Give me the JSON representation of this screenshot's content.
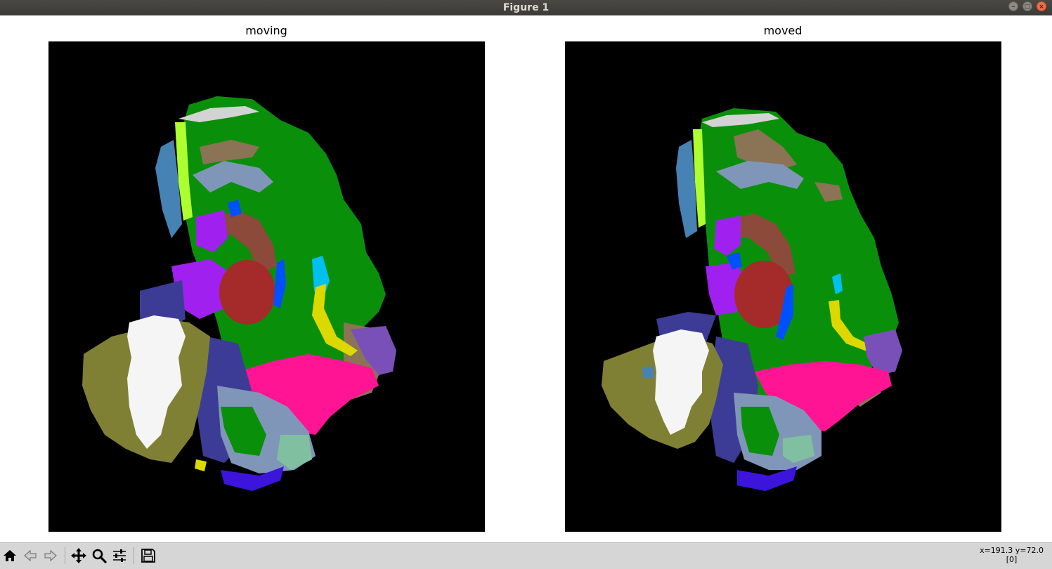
{
  "window": {
    "title": "Figure 1"
  },
  "axes": [
    {
      "title": "moving"
    },
    {
      "title": "moved"
    }
  ],
  "toolbar": {
    "buttons": [
      {
        "name": "home",
        "icon": "home-icon"
      },
      {
        "name": "back",
        "icon": "arrow-left-icon"
      },
      {
        "name": "forward",
        "icon": "arrow-right-icon"
      },
      {
        "name": "pan",
        "icon": "move-icon"
      },
      {
        "name": "zoom",
        "icon": "magnifier-icon"
      },
      {
        "name": "configure-subplots",
        "icon": "sliders-icon"
      },
      {
        "name": "save",
        "icon": "floppy-icon"
      }
    ],
    "coords_line1": "x=191.3 y=72.0",
    "coords_line2": "[0]"
  },
  "colors": {
    "axes_background": "#000000",
    "green": "#0a8f0a",
    "brown_red": "#a52a2a",
    "purple": "#a020f0",
    "olive": "#808035",
    "white": "#f5f5f5",
    "magenta": "#ff1493",
    "navy": "#3c3c96",
    "slate": "#8096b8",
    "yellow": "#dcd800",
    "lime": "#adff2f",
    "steel_blue": "#4682b4",
    "tan": "#8b7355",
    "cyan": "#00c0f0",
    "blue": "#0050ff",
    "aquamarine": "#80c0a0",
    "indigo": "#3c14dc",
    "silver": "#d3d3d3",
    "violet": "#7850b8"
  }
}
